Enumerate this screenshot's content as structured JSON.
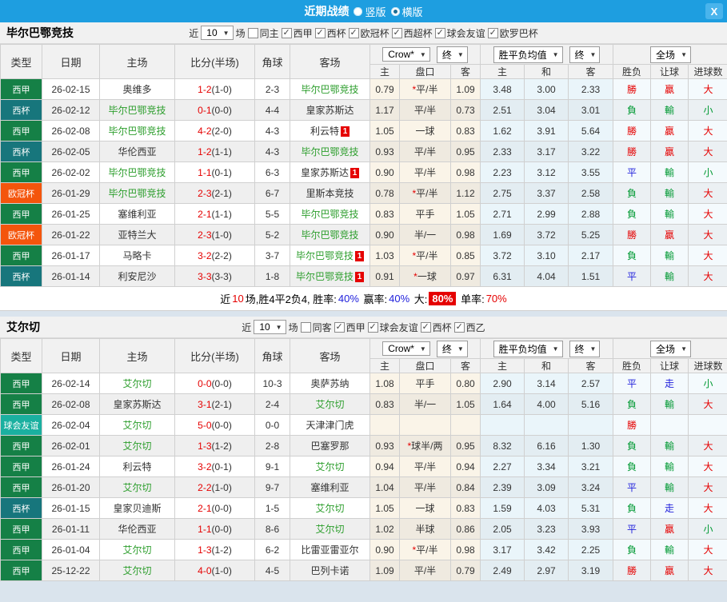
{
  "topbar": {
    "title": "近期战绩",
    "vertical_label": "竖版",
    "horizontal_label": "横版",
    "close_glyph": "X",
    "bar_color": "#1E9EE0"
  },
  "table_header": {
    "static_cols": [
      "类型",
      "日期",
      "主场",
      "比分(半场)",
      "角球",
      "客场"
    ],
    "odds_company": "Crow*",
    "final_label": "终",
    "avg_label": "胜平负均值",
    "scope_label": "全场",
    "odds_sub": [
      "主",
      "盘口",
      "客"
    ],
    "avg_sub": [
      "主",
      "和",
      "客"
    ],
    "result_sub": [
      "胜负",
      "让球",
      "进球数"
    ]
  },
  "type_colors": {
    "西甲": "#158046",
    "西杯": "#17767C",
    "欧冠杯": "#F4550C",
    "球会友谊": "#1AB0A0"
  },
  "sections": [
    {
      "team": "毕尔巴鄂竞技",
      "filter": {
        "near": "近",
        "count": "10",
        "unit": "场",
        "toggle": {
          "label": "同主",
          "checked": false
        },
        "leagues": [
          {
            "label": "西甲",
            "checked": true
          },
          {
            "label": "西杯",
            "checked": true
          },
          {
            "label": "欧冠杯",
            "checked": true
          },
          {
            "label": "西超杯",
            "checked": true
          },
          {
            "label": "球会友谊",
            "checked": true
          },
          {
            "label": "欧罗巴杯",
            "checked": true
          }
        ]
      },
      "rows": [
        {
          "type": "西甲",
          "date": "26-02-15",
          "home": "奥维多",
          "home_self": false,
          "home_red": "",
          "score": "1-2",
          "half": "(1-0)",
          "corner": "2-3",
          "away": "毕尔巴鄂竞技",
          "away_self": true,
          "away_red": "",
          "odds": [
            "0.79",
            "*平/半",
            "1.09"
          ],
          "avg": [
            "3.48",
            "3.00",
            "2.33"
          ],
          "res": [
            {
              "t": "勝",
              "c": "r"
            },
            {
              "t": "贏",
              "c": "r"
            },
            {
              "t": "大",
              "c": "r"
            }
          ]
        },
        {
          "type": "西杯",
          "date": "26-02-12",
          "home": "毕尔巴鄂竞技",
          "home_self": true,
          "home_red": "",
          "score": "0-1",
          "half": "(0-0)",
          "corner": "4-4",
          "away": "皇家苏斯达",
          "away_self": false,
          "away_red": "",
          "odds": [
            "1.17",
            "平/半",
            "0.73"
          ],
          "avg": [
            "2.51",
            "3.04",
            "3.01"
          ],
          "res": [
            {
              "t": "負",
              "c": "g"
            },
            {
              "t": "輸",
              "c": "g"
            },
            {
              "t": "小",
              "c": "g"
            }
          ]
        },
        {
          "type": "西甲",
          "date": "26-02-08",
          "home": "毕尔巴鄂竞技",
          "home_self": true,
          "home_red": "",
          "score": "4-2",
          "half": "(2-0)",
          "corner": "4-3",
          "away": "利云特",
          "away_self": false,
          "away_red": "1",
          "odds": [
            "1.05",
            "一球",
            "0.83"
          ],
          "avg": [
            "1.62",
            "3.91",
            "5.64"
          ],
          "res": [
            {
              "t": "勝",
              "c": "r"
            },
            {
              "t": "贏",
              "c": "r"
            },
            {
              "t": "大",
              "c": "r"
            }
          ]
        },
        {
          "type": "西杯",
          "date": "26-02-05",
          "home": "华伦西亚",
          "home_self": false,
          "home_red": "",
          "score": "1-2",
          "half": "(1-1)",
          "corner": "4-3",
          "away": "毕尔巴鄂竞技",
          "away_self": true,
          "away_red": "",
          "odds": [
            "0.93",
            "平/半",
            "0.95"
          ],
          "avg": [
            "2.33",
            "3.17",
            "3.22"
          ],
          "res": [
            {
              "t": "勝",
              "c": "r"
            },
            {
              "t": "贏",
              "c": "r"
            },
            {
              "t": "大",
              "c": "r"
            }
          ]
        },
        {
          "type": "西甲",
          "date": "26-02-02",
          "home": "毕尔巴鄂竞技",
          "home_self": true,
          "home_red": "",
          "score": "1-1",
          "half": "(0-1)",
          "corner": "6-3",
          "away": "皇家苏斯达",
          "away_self": false,
          "away_red": "1",
          "odds": [
            "0.90",
            "平/半",
            "0.98"
          ],
          "avg": [
            "2.23",
            "3.12",
            "3.55"
          ],
          "res": [
            {
              "t": "平",
              "c": "b"
            },
            {
              "t": "輸",
              "c": "g"
            },
            {
              "t": "小",
              "c": "g"
            }
          ]
        },
        {
          "type": "欧冠杯",
          "date": "26-01-29",
          "home": "毕尔巴鄂竞技",
          "home_self": true,
          "home_red": "",
          "score": "2-3",
          "half": "(2-1)",
          "corner": "6-7",
          "away": "里斯本竞技",
          "away_self": false,
          "away_red": "",
          "odds": [
            "0.78",
            "*平/半",
            "1.12"
          ],
          "avg": [
            "2.75",
            "3.37",
            "2.58"
          ],
          "res": [
            {
              "t": "負",
              "c": "g"
            },
            {
              "t": "輸",
              "c": "g"
            },
            {
              "t": "大",
              "c": "r"
            }
          ]
        },
        {
          "type": "西甲",
          "date": "26-01-25",
          "home": "塞维利亚",
          "home_self": false,
          "home_red": "",
          "score": "2-1",
          "half": "(1-1)",
          "corner": "5-5",
          "away": "毕尔巴鄂竞技",
          "away_self": true,
          "away_red": "",
          "odds": [
            "0.83",
            "平手",
            "1.05"
          ],
          "avg": [
            "2.71",
            "2.99",
            "2.88"
          ],
          "res": [
            {
              "t": "負",
              "c": "g"
            },
            {
              "t": "輸",
              "c": "g"
            },
            {
              "t": "大",
              "c": "r"
            }
          ]
        },
        {
          "type": "欧冠杯",
          "date": "26-01-22",
          "home": "亚特兰大",
          "home_self": false,
          "home_red": "",
          "score": "2-3",
          "half": "(1-0)",
          "corner": "5-2",
          "away": "毕尔巴鄂竞技",
          "away_self": true,
          "away_red": "",
          "odds": [
            "0.90",
            "半/一",
            "0.98"
          ],
          "avg": [
            "1.69",
            "3.72",
            "5.25"
          ],
          "res": [
            {
              "t": "勝",
              "c": "r"
            },
            {
              "t": "贏",
              "c": "r"
            },
            {
              "t": "大",
              "c": "r"
            }
          ]
        },
        {
          "type": "西甲",
          "date": "26-01-17",
          "home": "马略卡",
          "home_self": false,
          "home_red": "",
          "score": "3-2",
          "half": "(2-2)",
          "corner": "3-7",
          "away": "毕尔巴鄂竞技",
          "away_self": true,
          "away_red": "1",
          "odds": [
            "1.03",
            "*平/半",
            "0.85"
          ],
          "avg": [
            "3.72",
            "3.10",
            "2.17"
          ],
          "res": [
            {
              "t": "負",
              "c": "g"
            },
            {
              "t": "輸",
              "c": "g"
            },
            {
              "t": "大",
              "c": "r"
            }
          ]
        },
        {
          "type": "西杯",
          "date": "26-01-14",
          "home": "利安尼沙",
          "home_self": false,
          "home_red": "",
          "score": "3-3",
          "half": "(3-3)",
          "corner": "1-8",
          "away": "毕尔巴鄂竞技",
          "away_self": true,
          "away_red": "1",
          "odds": [
            "0.91",
            "*一球",
            "0.97"
          ],
          "avg": [
            "6.31",
            "4.04",
            "1.51"
          ],
          "res": [
            {
              "t": "平",
              "c": "b"
            },
            {
              "t": "輸",
              "c": "g"
            },
            {
              "t": "大",
              "c": "r"
            }
          ]
        }
      ],
      "summary": {
        "t1": "近",
        "count": "10",
        "t2": "场,胜4平2负4, 胜率:",
        "win": "40%",
        "t3": "赢率:",
        "profit": "40%",
        "t4": "大:",
        "big": "80%",
        "t5": "单率:",
        "single": "70%"
      }
    },
    {
      "team": "艾尔切",
      "filter": {
        "near": "近",
        "count": "10",
        "unit": "场",
        "toggle": {
          "label": "同客",
          "checked": false
        },
        "leagues": [
          {
            "label": "西甲",
            "checked": true
          },
          {
            "label": "球会友谊",
            "checked": true
          },
          {
            "label": "西杯",
            "checked": true
          },
          {
            "label": "西乙",
            "checked": true
          }
        ]
      },
      "rows": [
        {
          "type": "西甲",
          "date": "26-02-14",
          "home": "艾尔切",
          "home_self": true,
          "home_red": "",
          "score": "0-0",
          "half": "(0-0)",
          "corner": "10-3",
          "away": "奥萨苏纳",
          "away_self": false,
          "away_red": "",
          "odds": [
            "1.08",
            "平手",
            "0.80"
          ],
          "avg": [
            "2.90",
            "3.14",
            "2.57"
          ],
          "res": [
            {
              "t": "平",
              "c": "b"
            },
            {
              "t": "走",
              "c": "b"
            },
            {
              "t": "小",
              "c": "g"
            }
          ]
        },
        {
          "type": "西甲",
          "date": "26-02-08",
          "home": "皇家苏斯达",
          "home_self": false,
          "home_red": "",
          "score": "3-1",
          "half": "(2-1)",
          "corner": "2-4",
          "away": "艾尔切",
          "away_self": true,
          "away_red": "",
          "odds": [
            "0.83",
            "半/一",
            "1.05"
          ],
          "avg": [
            "1.64",
            "4.00",
            "5.16"
          ],
          "res": [
            {
              "t": "負",
              "c": "g"
            },
            {
              "t": "輸",
              "c": "g"
            },
            {
              "t": "大",
              "c": "r"
            }
          ]
        },
        {
          "type": "球会友谊",
          "date": "26-02-04",
          "home": "艾尔切",
          "home_self": true,
          "home_red": "",
          "score": "5-0",
          "half": "(0-0)",
          "corner": "0-0",
          "away": "天津津门虎",
          "away_self": false,
          "away_red": "",
          "odds": [
            "",
            "",
            ""
          ],
          "avg": [
            "",
            "",
            ""
          ],
          "res": [
            {
              "t": "勝",
              "c": "r"
            },
            {
              "t": "",
              "c": ""
            },
            {
              "t": "",
              "c": ""
            }
          ]
        },
        {
          "type": "西甲",
          "date": "26-02-01",
          "home": "艾尔切",
          "home_self": true,
          "home_red": "",
          "score": "1-3",
          "half": "(1-2)",
          "corner": "2-8",
          "away": "巴塞罗那",
          "away_self": false,
          "away_red": "",
          "odds": [
            "0.93",
            "*球半/两",
            "0.95"
          ],
          "avg": [
            "8.32",
            "6.16",
            "1.30"
          ],
          "res": [
            {
              "t": "負",
              "c": "g"
            },
            {
              "t": "輸",
              "c": "g"
            },
            {
              "t": "大",
              "c": "r"
            }
          ]
        },
        {
          "type": "西甲",
          "date": "26-01-24",
          "home": "利云特",
          "home_self": false,
          "home_red": "",
          "score": "3-2",
          "half": "(0-1)",
          "corner": "9-1",
          "away": "艾尔切",
          "away_self": true,
          "away_red": "",
          "odds": [
            "0.94",
            "平/半",
            "0.94"
          ],
          "avg": [
            "2.27",
            "3.34",
            "3.21"
          ],
          "res": [
            {
              "t": "負",
              "c": "g"
            },
            {
              "t": "輸",
              "c": "g"
            },
            {
              "t": "大",
              "c": "r"
            }
          ]
        },
        {
          "type": "西甲",
          "date": "26-01-20",
          "home": "艾尔切",
          "home_self": true,
          "home_red": "",
          "score": "2-2",
          "half": "(1-0)",
          "corner": "9-7",
          "away": "塞维利亚",
          "away_self": false,
          "away_red": "",
          "odds": [
            "1.04",
            "平/半",
            "0.84"
          ],
          "avg": [
            "2.39",
            "3.09",
            "3.24"
          ],
          "res": [
            {
              "t": "平",
              "c": "b"
            },
            {
              "t": "輸",
              "c": "g"
            },
            {
              "t": "大",
              "c": "r"
            }
          ]
        },
        {
          "type": "西杯",
          "date": "26-01-15",
          "home": "皇家贝迪斯",
          "home_self": false,
          "home_red": "",
          "score": "2-1",
          "half": "(0-0)",
          "corner": "1-5",
          "away": "艾尔切",
          "away_self": true,
          "away_red": "",
          "odds": [
            "1.05",
            "一球",
            "0.83"
          ],
          "avg": [
            "1.59",
            "4.03",
            "5.31"
          ],
          "res": [
            {
              "t": "負",
              "c": "g"
            },
            {
              "t": "走",
              "c": "b"
            },
            {
              "t": "大",
              "c": "r"
            }
          ]
        },
        {
          "type": "西甲",
          "date": "26-01-11",
          "home": "华伦西亚",
          "home_self": false,
          "home_red": "",
          "score": "1-1",
          "half": "(0-0)",
          "corner": "8-6",
          "away": "艾尔切",
          "away_self": true,
          "away_red": "",
          "odds": [
            "1.02",
            "半球",
            "0.86"
          ],
          "avg": [
            "2.05",
            "3.23",
            "3.93"
          ],
          "res": [
            {
              "t": "平",
              "c": "b"
            },
            {
              "t": "贏",
              "c": "r"
            },
            {
              "t": "小",
              "c": "g"
            }
          ]
        },
        {
          "type": "西甲",
          "date": "26-01-04",
          "home": "艾尔切",
          "home_self": true,
          "home_red": "",
          "score": "1-3",
          "half": "(1-2)",
          "corner": "6-2",
          "away": "比雷亚雷亚尔",
          "away_self": false,
          "away_red": "",
          "odds": [
            "0.90",
            "*平/半",
            "0.98"
          ],
          "avg": [
            "3.17",
            "3.42",
            "2.25"
          ],
          "res": [
            {
              "t": "負",
              "c": "g"
            },
            {
              "t": "輸",
              "c": "g"
            },
            {
              "t": "大",
              "c": "r"
            }
          ]
        },
        {
          "type": "西甲",
          "date": "25-12-22",
          "home": "艾尔切",
          "home_self": true,
          "home_red": "",
          "score": "4-0",
          "half": "(1-0)",
          "corner": "4-5",
          "away": "巴列卡诺",
          "away_self": false,
          "away_red": "",
          "odds": [
            "1.09",
            "平/半",
            "0.79"
          ],
          "avg": [
            "2.49",
            "2.97",
            "3.19"
          ],
          "res": [
            {
              "t": "勝",
              "c": "r"
            },
            {
              "t": "贏",
              "c": "r"
            },
            {
              "t": "大",
              "c": "r"
            }
          ]
        }
      ],
      "summary": null
    }
  ]
}
